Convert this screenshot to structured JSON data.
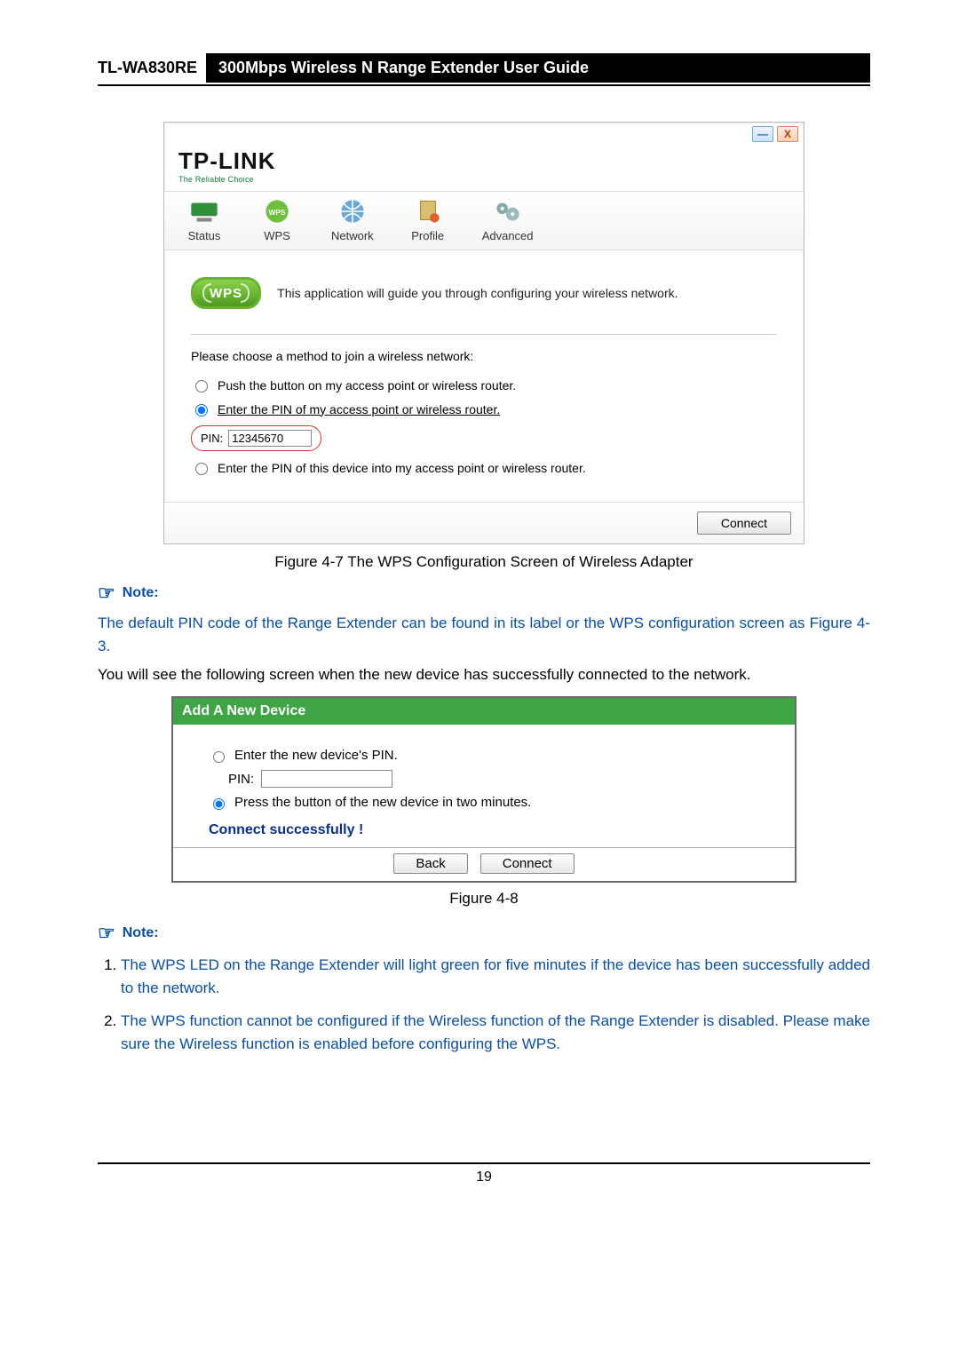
{
  "header": {
    "model": "TL-WA830RE",
    "title": "300Mbps Wireless N Range Extender User Guide"
  },
  "win": {
    "logo": "TP-LINK",
    "logo_sub": "The Reliable Choice",
    "minimize": "—",
    "close": "X",
    "tabs": {
      "status": "Status",
      "wps": "WPS",
      "network": "Network",
      "profile": "Profile",
      "advanced": "Advanced"
    },
    "wps_badge": "WPS",
    "intro": "This application will guide you through configuring your wireless network.",
    "method_label": "Please choose a method to join a wireless network:",
    "opt_push": "Push the button on my access point or wireless router.",
    "opt_enter_ap": "Enter the PIN of my access point or wireless router.",
    "pin_label": "PIN:",
    "pin_value": "12345670",
    "opt_enter_dev": "Enter the PIN of this device into my access point or wireless router.",
    "connect": "Connect"
  },
  "caption1": "Figure 4-7 The WPS Configuration Screen of Wireless Adapter",
  "note_label": "Note:",
  "note1_text": "The default PIN code of the Range Extender can be found in its label or the WPS configuration screen as Figure 4-3.",
  "body2": "You will see the following screen when the new device has successfully connected to the network.",
  "panel2": {
    "title": "Add A New Device",
    "opt_pin": "Enter the new device's PIN.",
    "pin_label": "PIN:",
    "pin_value": "",
    "opt_press": "Press the button of the new device in two minutes.",
    "success": "Connect successfully !",
    "back": "Back",
    "connect": "Connect"
  },
  "caption2": "Figure 4-8",
  "note_list": {
    "i1": "The WPS LED on the Range Extender will light green for five minutes if the device has been successfully added to the network.",
    "i2": "The WPS function cannot be configured if the Wireless function of the Range Extender is disabled. Please make sure the Wireless function is enabled before configuring the WPS."
  },
  "page_number": "19"
}
